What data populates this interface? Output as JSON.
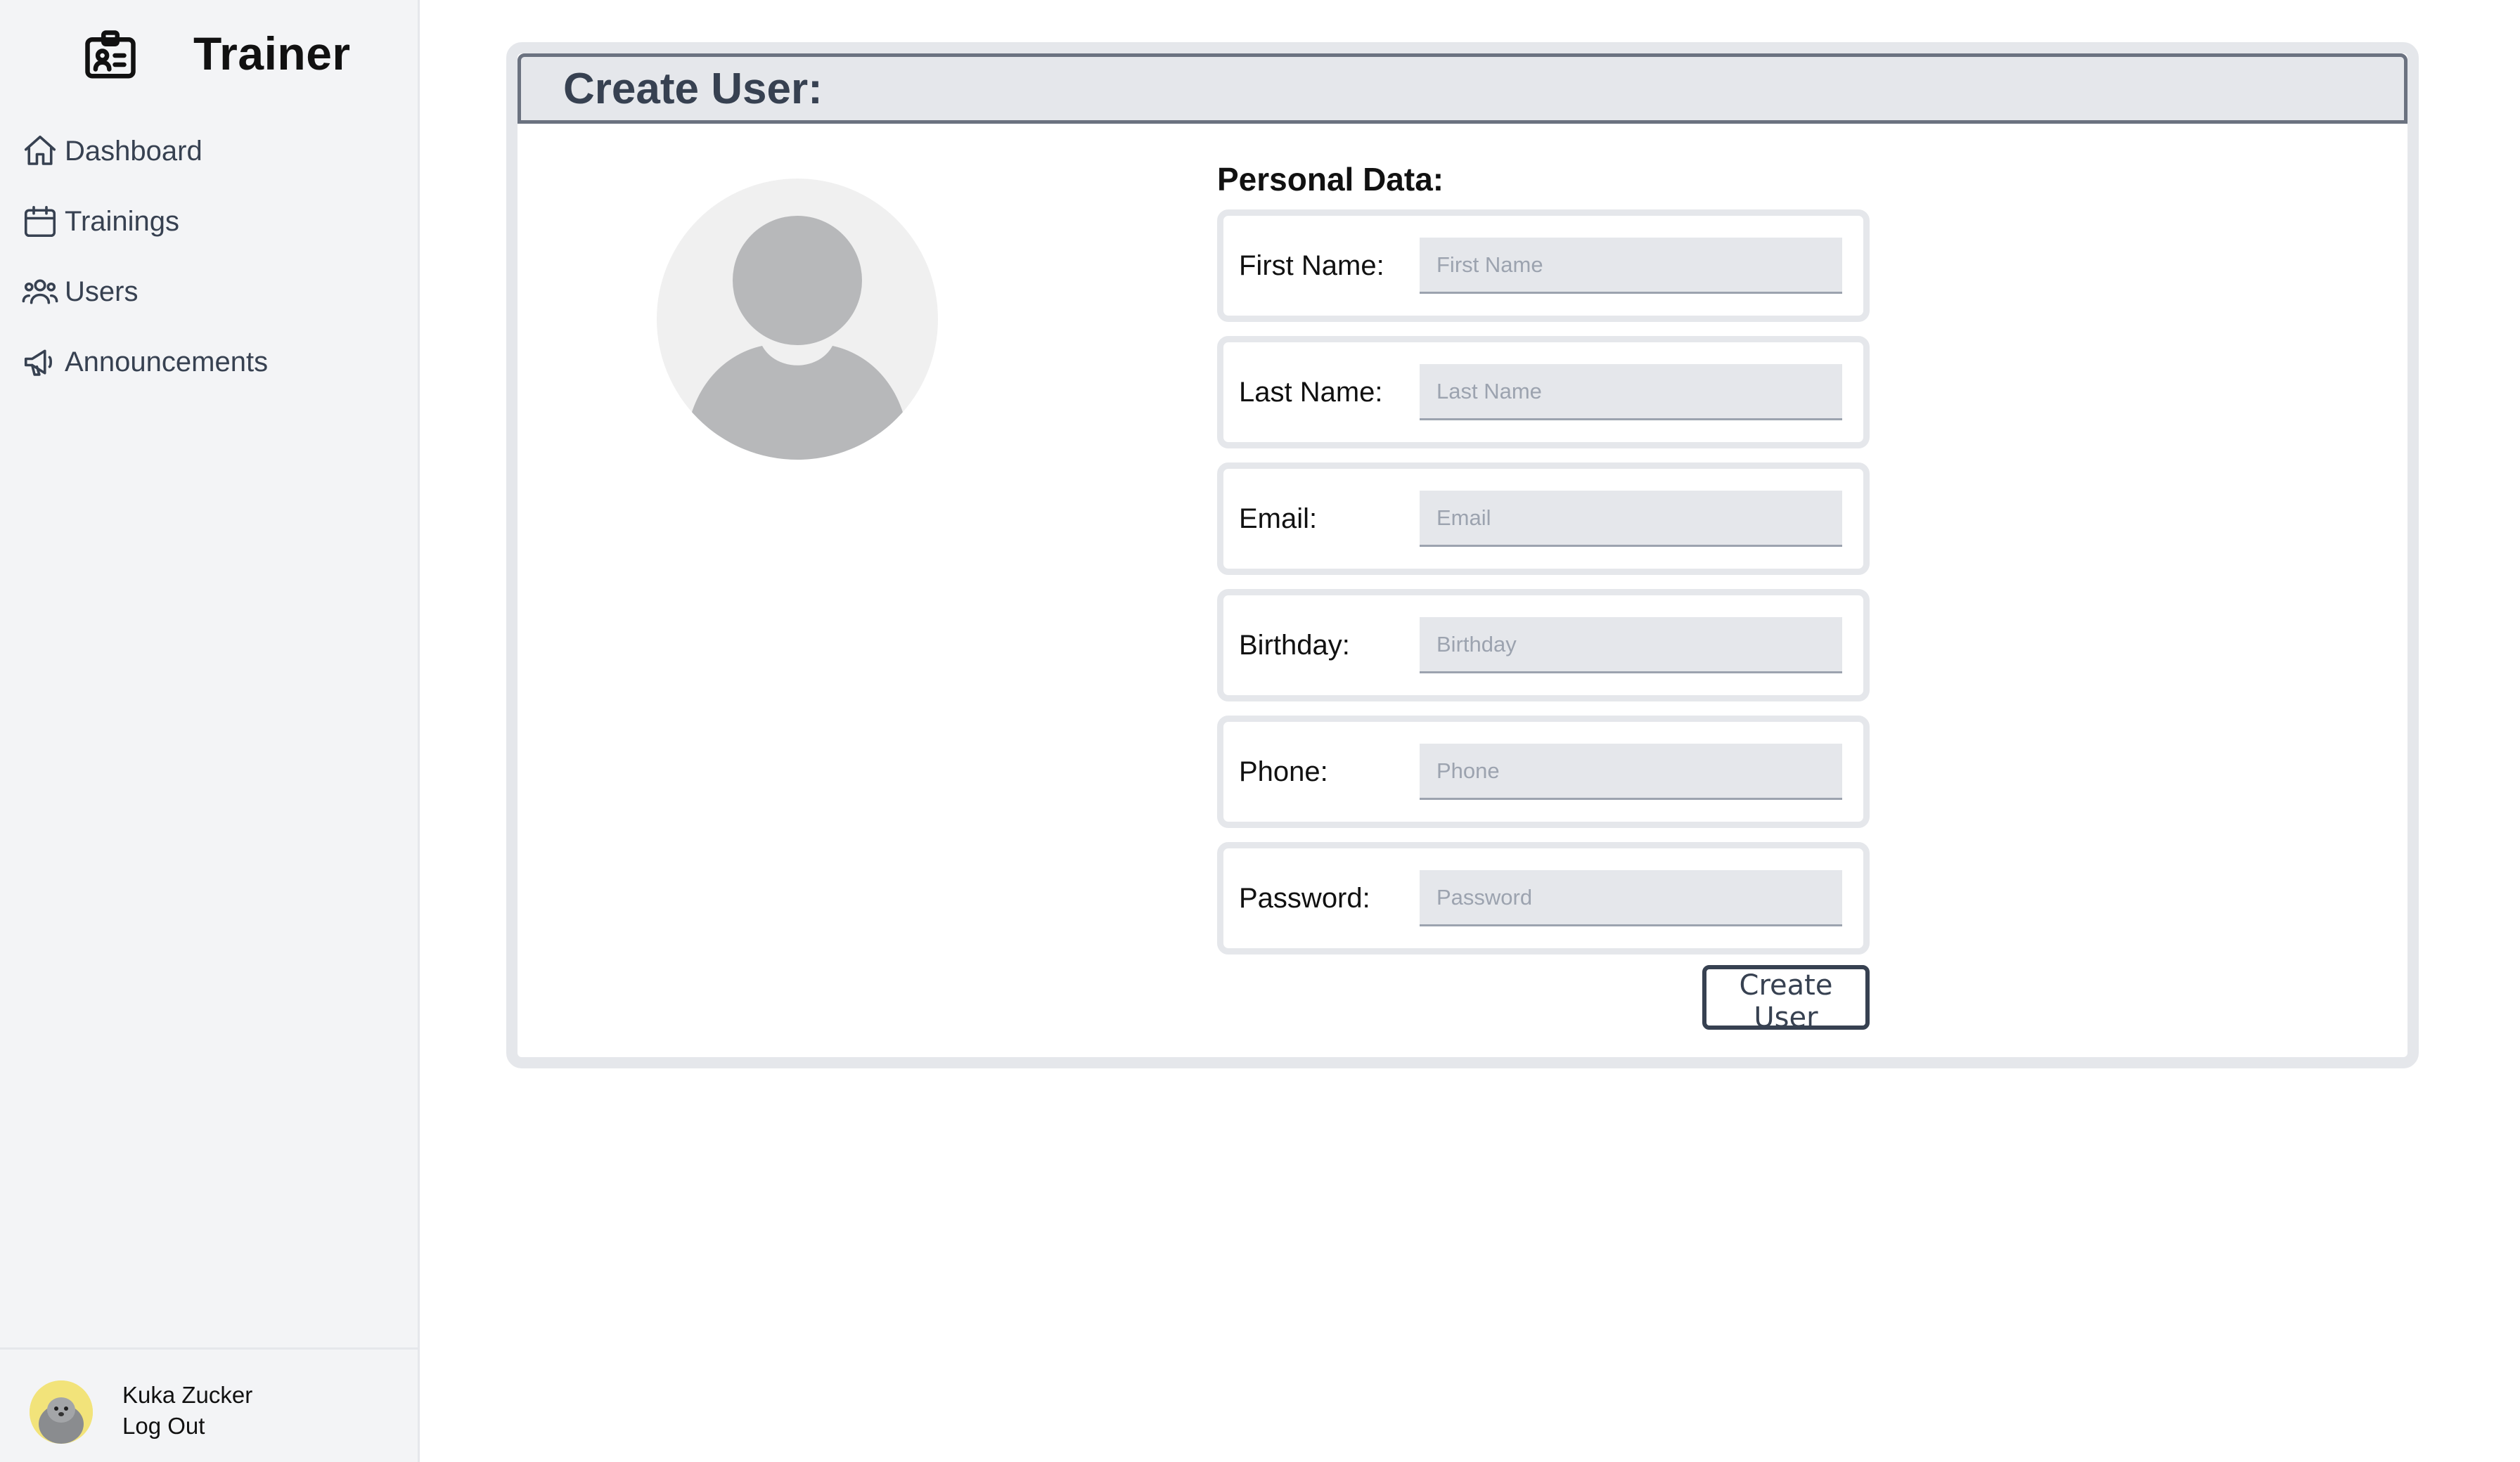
{
  "app": {
    "title": "Trainer"
  },
  "sidebar": {
    "items": [
      {
        "label": "Dashboard",
        "icon": "home-icon"
      },
      {
        "label": "Trainings",
        "icon": "calendar-icon"
      },
      {
        "label": "Users",
        "icon": "users-icon"
      },
      {
        "label": "Announcements",
        "icon": "megaphone-icon"
      }
    ]
  },
  "user": {
    "name": "Kuka Zucker",
    "logout_label": "Log Out"
  },
  "main": {
    "title": "Create User:",
    "section_title": "Personal Data:",
    "fields": [
      {
        "label": "First Name:",
        "placeholder": "First Name",
        "value": ""
      },
      {
        "label": "Last Name:",
        "placeholder": "Last Name",
        "value": ""
      },
      {
        "label": "Email:",
        "placeholder": "Email",
        "value": ""
      },
      {
        "label": "Birthday:",
        "placeholder": "Birthday",
        "value": ""
      },
      {
        "label": "Phone:",
        "placeholder": "Phone",
        "value": ""
      },
      {
        "label": "Password:",
        "placeholder": "Password",
        "value": ""
      }
    ],
    "submit_label": "Create User"
  },
  "colors": {
    "sidebar_bg": "#f3f4f6",
    "border": "#e5e7eb",
    "input_bg": "#e5e7eb",
    "text_muted": "#374151",
    "avatar_placeholder": "#b7b8ba"
  }
}
